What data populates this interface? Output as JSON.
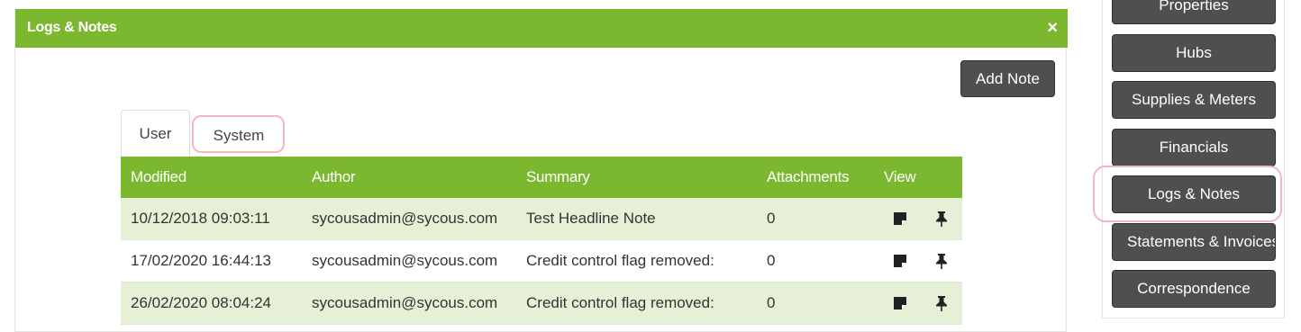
{
  "panel": {
    "title": "Logs & Notes",
    "close_glyph": "×",
    "add_note_label": "Add Note"
  },
  "tabs": [
    {
      "label": "User",
      "active": true
    },
    {
      "label": "System",
      "active": false
    }
  ],
  "table": {
    "headers": [
      "Modified",
      "Author",
      "Summary",
      "Attachments",
      "View"
    ],
    "rows": [
      {
        "modified": "10/12/2018 09:03:11",
        "author": "sycousadmin@sycous.com",
        "summary": "Test Headline Note",
        "attachments": "0"
      },
      {
        "modified": "17/02/2020 16:44:13",
        "author": "sycousadmin@sycous.com",
        "summary": "Credit control flag removed:",
        "attachments": "0"
      },
      {
        "modified": "26/02/2020 08:04:24",
        "author": "sycousadmin@sycous.com",
        "summary": "Credit control flag removed:",
        "attachments": "0"
      }
    ],
    "row_icons": [
      "note-icon",
      "pin-icon"
    ]
  },
  "sidebar": {
    "items": [
      {
        "label": "Properties"
      },
      {
        "label": "Hubs"
      },
      {
        "label": "Supplies & Meters"
      },
      {
        "label": "Financials"
      },
      {
        "label": "Logs & Notes"
      },
      {
        "label": "Statements & Invoices"
      },
      {
        "label": "Correspondence"
      }
    ]
  },
  "colors": {
    "header_green": "#7cb82f",
    "alt_row": "#e6f0d7",
    "button_dark": "#4f4f4f",
    "highlight": "#f3b8bd"
  }
}
